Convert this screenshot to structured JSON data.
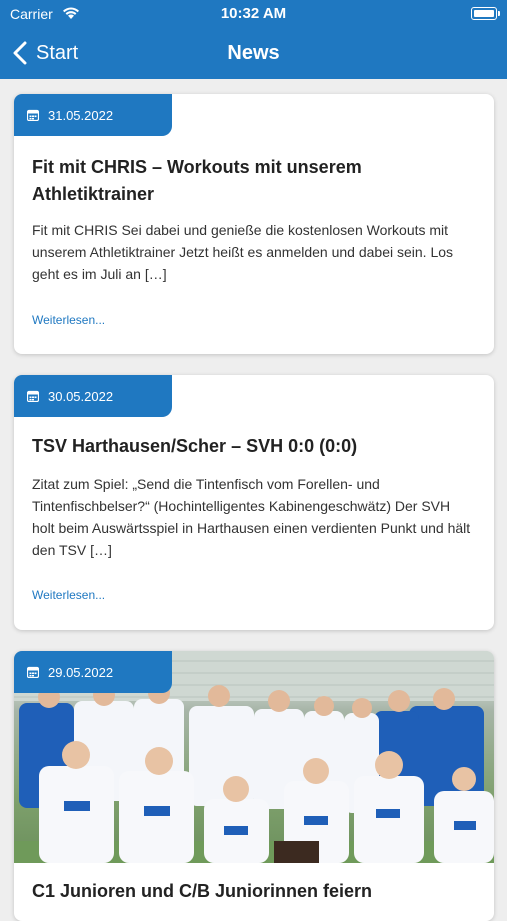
{
  "status_bar": {
    "carrier": "Carrier",
    "time": "10:32 AM"
  },
  "nav": {
    "back_label": "Start",
    "title": "News"
  },
  "articles": [
    {
      "date": "31.05.2022",
      "title": "Fit mit CHRIS – Workouts mit unserem Athletiktrainer",
      "excerpt": "Fit mit CHRIS Sei dabei und genieße die kostenlosen Workouts mit unserem Athletiktrainer Jetzt heißt es anmelden und dabei sein. Los geht es im Juli an […]",
      "link": "Weiterlesen..."
    },
    {
      "date": "30.05.2022",
      "title": "TSV Harthausen/Scher – SVH 0:0 (0:0)",
      "excerpt": "Zitat zum Spiel: „Send die Tintenfisch vom Forellen- und Tintenfischbelser?“ (Hochintelligentes Kabinengeschwätz) Der SVH holt beim Auswärtsspiel in Harthausen einen verdienten Punkt und hält den TSV […]",
      "link": "Weiterlesen..."
    },
    {
      "date": "29.05.2022",
      "title": "C1 Junioren und C/B Juniorinnen feiern"
    }
  ],
  "icons": {
    "back": "chevron-left-icon",
    "calendar": "calendar-icon",
    "wifi": "wifi-icon",
    "battery": "battery-icon"
  },
  "colors": {
    "accent": "#1f78c1",
    "background": "#eeeeee",
    "link": "#1f78c1"
  }
}
